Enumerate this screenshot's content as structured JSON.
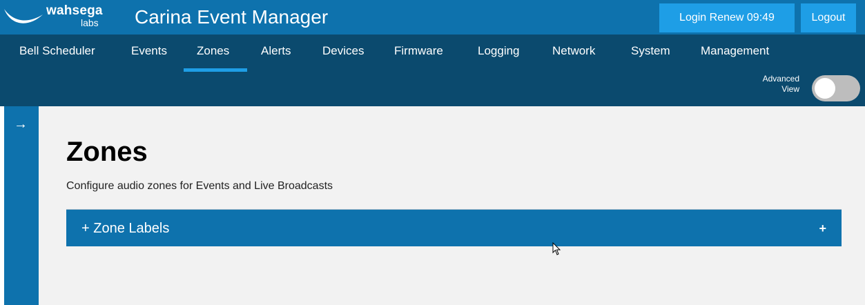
{
  "brand": {
    "logo_word": "wahsega",
    "logo_sub": "labs",
    "app_title": "Carina Event Manager"
  },
  "header": {
    "login_renew": "Login Renew 09:49",
    "logout": "Logout"
  },
  "nav": {
    "items": [
      {
        "label": "Bell Scheduler",
        "active": false
      },
      {
        "label": "Events",
        "active": false
      },
      {
        "label": "Zones",
        "active": true
      },
      {
        "label": "Alerts",
        "active": false
      },
      {
        "label": "Devices",
        "active": false
      },
      {
        "label": "Firmware",
        "active": false
      },
      {
        "label": "Logging",
        "active": false
      },
      {
        "label": "Network",
        "active": false
      },
      {
        "label": "System",
        "active": false
      },
      {
        "label": "Management",
        "active": false
      }
    ],
    "advanced_view_line1": "Advanced",
    "advanced_view_line2": "View",
    "advanced_view_enabled": false
  },
  "sidebar": {
    "toggle_icon": "arrow-right-icon",
    "toggle_glyph": "→"
  },
  "main": {
    "title": "Zones",
    "subtitle": "Configure audio zones for Events and Live Broadcasts",
    "accordion": {
      "label": "+ Zone Labels",
      "expand_glyph": "+",
      "expanded": false
    }
  },
  "colors": {
    "topbar": "#0e72ad",
    "navbar": "#0b4a6e",
    "accent": "#1e9ee6",
    "content_bg": "#f2f2f2"
  }
}
